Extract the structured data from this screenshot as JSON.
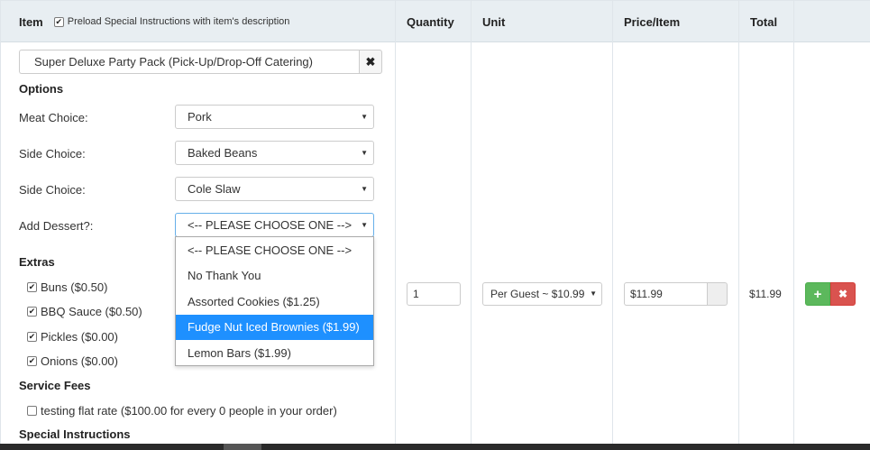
{
  "header": {
    "item": "Item",
    "preload_label": "Preload Special Instructions with item's description",
    "preload_checked": true,
    "quantity": "Quantity",
    "unit": "Unit",
    "price_item": "Price/Item",
    "total": "Total"
  },
  "item": {
    "name": "Super Deluxe Party Pack (Pick-Up/Drop-Off Catering)",
    "clear_icon": "close-icon"
  },
  "options": {
    "title": "Options",
    "rows": [
      {
        "label": "Meat Choice:",
        "value": "Pork"
      },
      {
        "label": "Side Choice:",
        "value": "Baked Beans"
      },
      {
        "label": "Side Choice:",
        "value": "Cole Slaw"
      },
      {
        "label": "Add Dessert?:",
        "value": "<-- PLEASE CHOOSE ONE -->"
      }
    ]
  },
  "dessert_dropdown": {
    "options": [
      "<-- PLEASE CHOOSE ONE -->",
      "No Thank You",
      "Assorted Cookies ($1.25)",
      "Fudge Nut Iced Brownies ($1.99)",
      "Lemon Bars ($1.99)"
    ],
    "highlighted": "Fudge Nut Iced Brownies ($1.99)",
    "highlight_color": "#1e90ff"
  },
  "extras": {
    "title": "Extras",
    "items": [
      {
        "label": "Buns ($0.50)",
        "checked": true
      },
      {
        "label": "BBQ Sauce ($0.50)",
        "checked": true
      },
      {
        "label": "Pickles ($0.00)",
        "checked": true
      },
      {
        "label": "Onions ($0.00)",
        "checked": true
      }
    ]
  },
  "service_fees": {
    "title": "Service Fees",
    "items": [
      {
        "label": "testing flat rate ($100.00 for every 0 people in your order)",
        "checked": false
      }
    ]
  },
  "special_instructions": {
    "title": "Special Instructions"
  },
  "quantity": {
    "value": "1"
  },
  "unit": {
    "value": "Per Guest ~ $10.99"
  },
  "price": {
    "value": "$11.99"
  },
  "total": {
    "value": "$11.99"
  },
  "actions": {
    "add_icon": "plus-icon",
    "delete_icon": "close-icon",
    "add_color": "#5cb85c",
    "delete_color": "#d9534f"
  }
}
